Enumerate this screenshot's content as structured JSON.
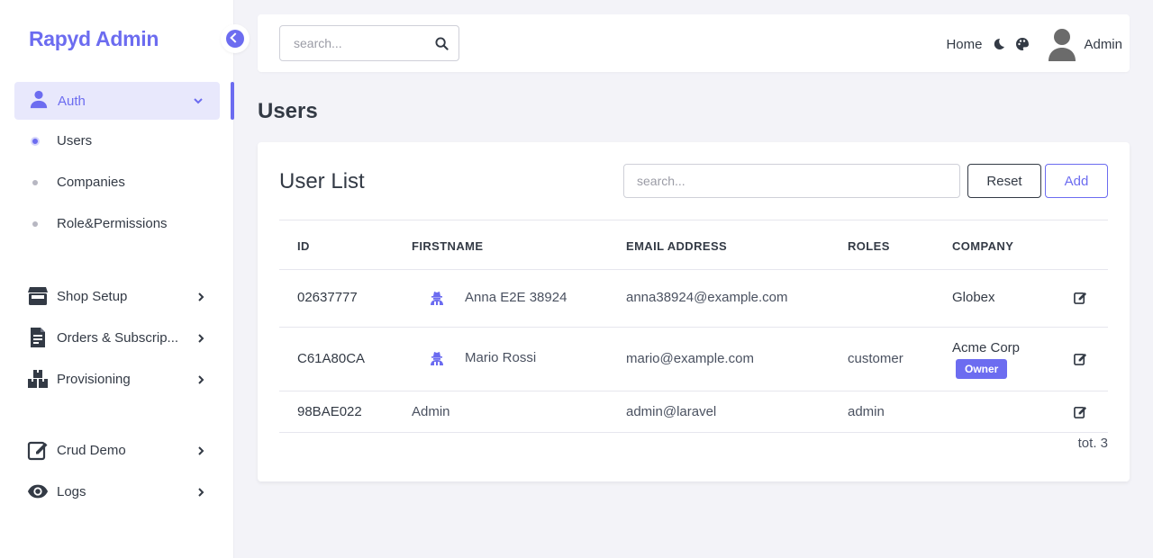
{
  "brand": "Rapyd Admin",
  "colors": {
    "accent": "#6c6cf0",
    "text": "#333a45",
    "bg": "#f3f3f8"
  },
  "sidebar": {
    "auth": {
      "label": "Auth",
      "icon": "user-icon"
    },
    "auth_children": [
      {
        "label": "Users",
        "active": true
      },
      {
        "label": "Companies",
        "active": false
      },
      {
        "label": "Role&Permissions",
        "active": false
      }
    ],
    "items": [
      {
        "label": "Shop Setup",
        "icon": "store-icon"
      },
      {
        "label": "Orders & Subscrip...",
        "icon": "file-invoice-icon"
      },
      {
        "label": "Provisioning",
        "icon": "boxes-icon"
      },
      {
        "label": "Crud Demo",
        "icon": "edit-icon"
      },
      {
        "label": "Logs",
        "icon": "eye-icon"
      }
    ]
  },
  "topbar": {
    "search_placeholder": "search...",
    "home": "Home",
    "user": "Admin"
  },
  "page_title": "Users",
  "card": {
    "title": "User List",
    "search_placeholder": "search...",
    "reset": "Reset",
    "add": "Add"
  },
  "table": {
    "headers": [
      "ID",
      "FIRSTNAME",
      "EMAIL ADDRESS",
      "ROLES",
      "COMPANY"
    ],
    "rows": [
      {
        "id": "02637777",
        "firstname": "Anna E2E 38924",
        "impersonate_icon": true,
        "email": "anna38924@example.com",
        "roles": "",
        "company": "Globex",
        "badge": ""
      },
      {
        "id": "C61A80CA",
        "firstname": "Mario Rossi",
        "impersonate_icon": true,
        "email": "mario@example.com",
        "roles": "customer",
        "company": "Acme Corp",
        "badge": "Owner"
      },
      {
        "id": "98BAE022",
        "firstname": "Admin",
        "impersonate_icon": false,
        "email": "admin@laravel",
        "roles": "admin",
        "company": "",
        "badge": ""
      }
    ],
    "total": "tot. 3"
  }
}
